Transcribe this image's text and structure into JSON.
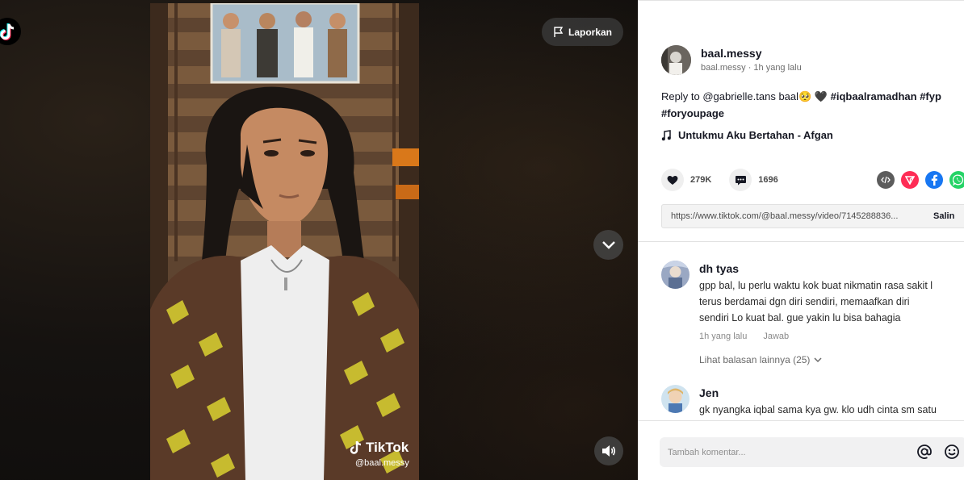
{
  "colors": {
    "accent": "#fe2c55",
    "text": "#161823",
    "muted": "#8a8a8a",
    "facebook": "#1877f2",
    "whatsapp": "#25d366",
    "embed": "#5c5c5c"
  },
  "video": {
    "report_label": "Laporkan",
    "watermark_brand": "TikTok",
    "watermark_user": "@baal.messy",
    "icons": {
      "logo": "tiktok-logo-icon",
      "report": "flag-icon",
      "next": "chevron-down-icon",
      "volume": "volume-icon"
    }
  },
  "author": {
    "username": "baal.messy",
    "meta": "baal.messy · 1h yang lalu"
  },
  "caption": {
    "reply_prefix": "Reply to ",
    "reply_user": "@gabrielle.tans",
    "text": " baal🥺 🖤 ",
    "tags": [
      "#iqbaalramadhan",
      "#fyp",
      "#foryoupage"
    ]
  },
  "music": {
    "title": "Untukmu Aku Bertahan - Afgan",
    "icon": "music-note-icon"
  },
  "stats": {
    "likes": "279K",
    "comments": "1696"
  },
  "share_icons": [
    "embed-icon",
    "send-icon",
    "facebook-icon",
    "whatsapp-icon"
  ],
  "share_link": {
    "url": "https://www.tiktok.com/@baal.messy/video/7145288836...",
    "copy_label": "Salin"
  },
  "comments": [
    {
      "user": "dh tyas",
      "lines": [
        "gpp bal, lu perlu waktu kok buat nikmatin rasa sakit l",
        "terus berdamai dgn diri sendiri, memaafkan diri",
        "sendiri Lo kuat bal. gue yakin lu bisa bahagia"
      ],
      "time": "1h yang lalu",
      "reply_label": "Jawab",
      "more": "Lihat balasan lainnya (25)"
    },
    {
      "user": "Jen",
      "lines": [
        "gk nyangka iqbal sama kya gw. klo udh cinta sm satu"
      ]
    }
  ],
  "composer": {
    "placeholder": "Tambah komentar...",
    "icons": [
      "mention-icon",
      "emoji-icon"
    ]
  }
}
